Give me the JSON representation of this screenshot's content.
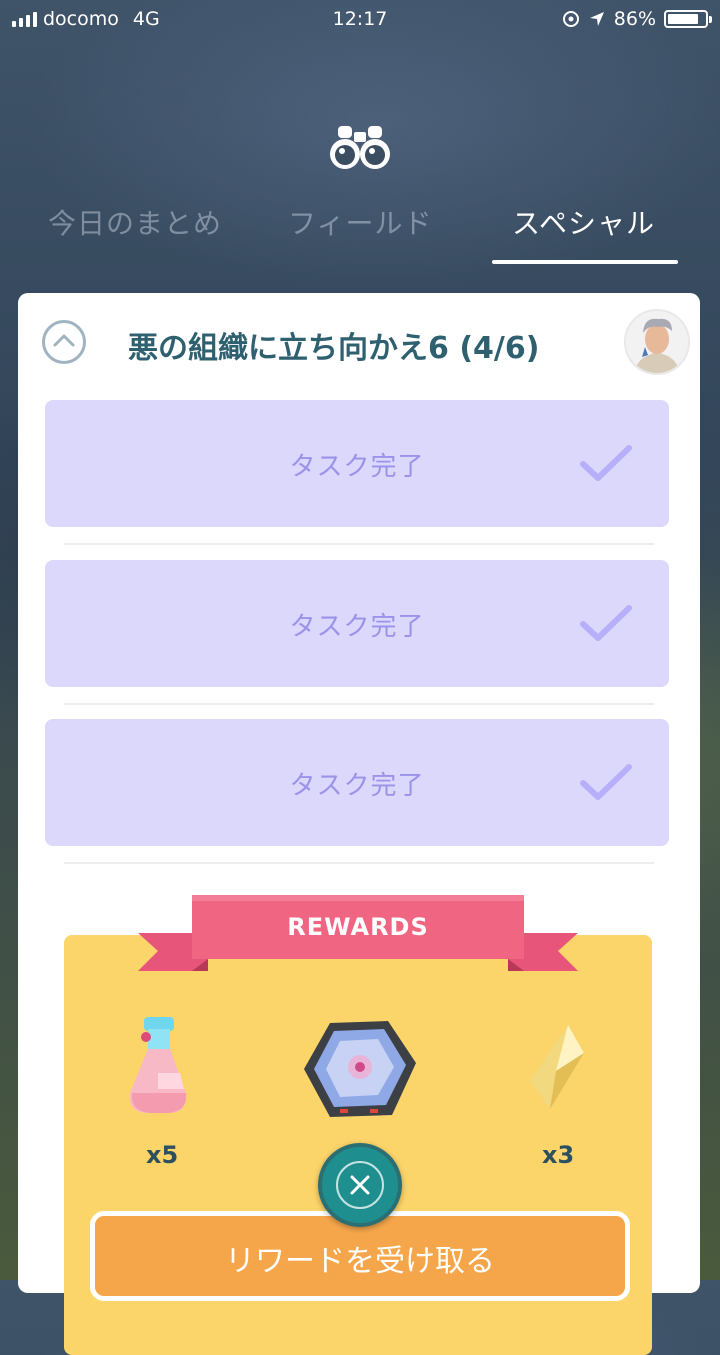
{
  "status_bar": {
    "carrier": "docomo",
    "network": "4G",
    "time": "12:17",
    "battery": "86%",
    "battery_level": 0.86
  },
  "header": {
    "icon": "binoculars-icon",
    "tabs": [
      {
        "label": "今日のまとめ",
        "active": false
      },
      {
        "label": "フィールド",
        "active": false
      },
      {
        "label": "スペシャル",
        "active": true
      }
    ]
  },
  "quest": {
    "title": "悪の組織に立ち向かえ6 (4/6)",
    "avatar": "trainer-avatar",
    "tasks": [
      {
        "label": "タスク完了",
        "completed": true
      },
      {
        "label": "タスク完了",
        "completed": true
      },
      {
        "label": "タスク完了",
        "completed": true
      }
    ]
  },
  "rewards": {
    "title": "REWARDS",
    "items": [
      {
        "icon": "hyper-potion-icon",
        "qty": "x5"
      },
      {
        "icon": "rocket-radar-icon",
        "qty": ""
      },
      {
        "icon": "golden-stardust-icon",
        "qty": "x3"
      }
    ],
    "claim_label": "リワードを受け取る"
  },
  "colors": {
    "task_bg": "#dcd8fb",
    "task_text": "#9b92ea",
    "rewards_bg": "#fbd46a",
    "ribbon": "#f06582",
    "claim_button": "#f6a64a",
    "close_button": "#1e8e8e"
  }
}
